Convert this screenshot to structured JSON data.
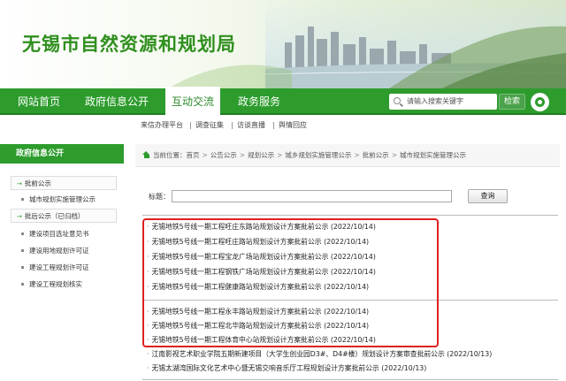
{
  "header": {
    "title": "无锡市自然资源和规划局"
  },
  "nav": {
    "items": [
      "网站首页",
      "政府信息公开",
      "互动交流",
      "政务服务"
    ],
    "active_index": 2,
    "search_placeholder": "请输入搜索关键字",
    "search_button": "检索"
  },
  "subnav": {
    "items": [
      "来信办理平台",
      "调查征集",
      "访谈直播",
      "舆情回应"
    ]
  },
  "sidebar": {
    "heading": "政府信息公开",
    "items": [
      {
        "label": "批前公示",
        "style": "boxed"
      },
      {
        "label": "城市规划实施管理公示",
        "style": "bullet"
      },
      {
        "label": "批后公示（已归档）",
        "style": "boxed"
      },
      {
        "label": "建设项目选址意见书",
        "style": "bullet"
      },
      {
        "label": "建设用地规划许可证",
        "style": "bullet"
      },
      {
        "label": "建设工程规划许可证",
        "style": "bullet"
      },
      {
        "label": "建设工程规划核实",
        "style": "bullet"
      }
    ]
  },
  "breadcrumb": {
    "prefix": "当前位置：",
    "items": [
      "首页",
      "公告公示",
      "规划公示",
      "城乡规划实施管理公示",
      "批前公示",
      "城市规划实施管理公示"
    ]
  },
  "filter": {
    "label": "标题：",
    "value": "",
    "button": "查询"
  },
  "news": [
    {
      "title": "无锡地铁5号线一期工程旺庄东路站规划设计方案批前公示",
      "date": "(2022/10/14)"
    },
    {
      "title": "无锡地铁5号线一期工程旺庄路站规划设计方案批前公示",
      "date": "(2022/10/14)"
    },
    {
      "title": "无锡地铁5号线一期工程宝龙广场站规划设计方案批前公示",
      "date": "(2022/10/14)"
    },
    {
      "title": "无锡地铁5号线一期工程钢铁广场站规划设计方案批前公示",
      "date": "(2022/10/14)"
    },
    {
      "title": "无锡地铁5号线一期工程健康路站规划设计方案批前公示",
      "date": "(2022/10/14)"
    },
    {
      "title": "无锡地铁5号线一期工程永丰路站规划设计方案批前公示",
      "date": "(2022/10/14)"
    },
    {
      "title": "无锡地铁5号线一期工程北华路站规划设计方案批前公示",
      "date": "(2022/10/14)"
    },
    {
      "title": "无锡地铁5号线一期工程体育中心站规划设计方案批前公示",
      "date": "(2022/10/14)"
    },
    {
      "title": "江南影视艺术职业学院五期新建项目（大学生创业园D3#、D4#楼）规划设计方案审查批前公示",
      "date": "(2022/10/13)"
    },
    {
      "title": "无锡太湖湾国际文化艺术中心暨无锡交响音乐厅工程规划设计方案批前公示",
      "date": "(2022/10/13)"
    }
  ],
  "colors": {
    "brand_green": "#2d9c2d",
    "highlight_red": "#e02020"
  }
}
